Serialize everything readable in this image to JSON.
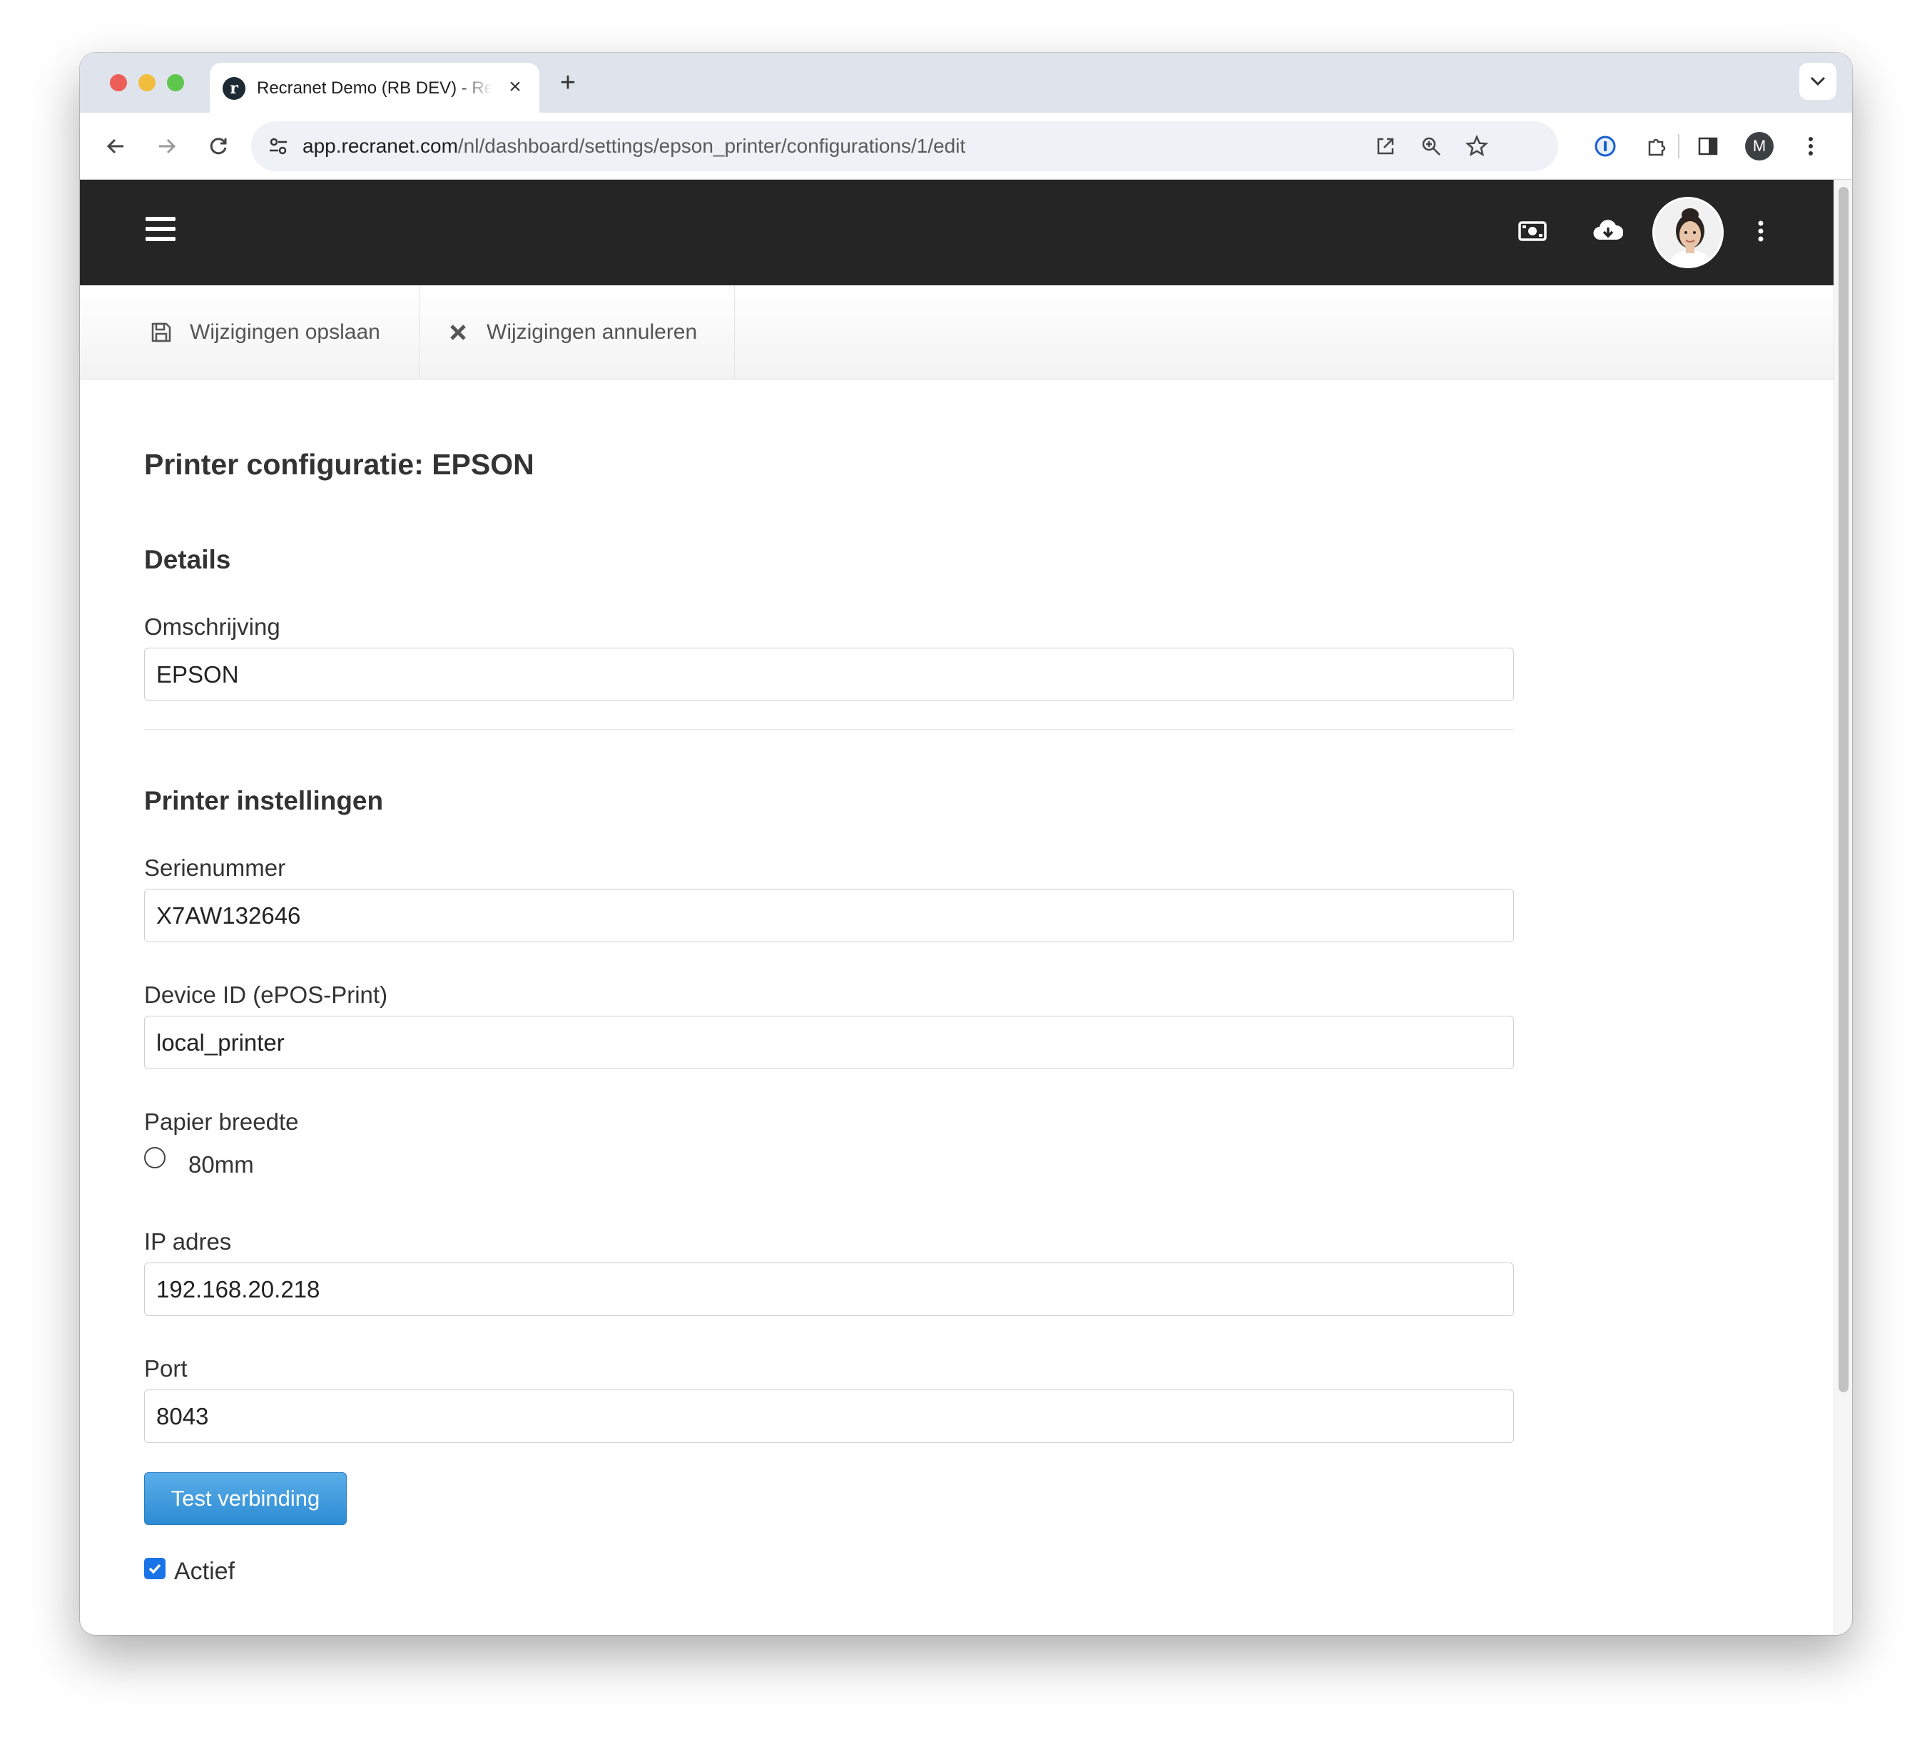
{
  "browser": {
    "tab_title": "Recranet Demo (RB DEV) - Recranet",
    "tab_favicon": "r",
    "url_host": "app.recranet.com",
    "url_path": "/nl/dashboard/settings/epson_printer/configurations/1/edit",
    "profile_initial": "M"
  },
  "actions": {
    "save_label": "Wijzigingen opslaan",
    "cancel_label": "Wijzigingen annuleren"
  },
  "page": {
    "title": "Printer configuratie: EPSON"
  },
  "details": {
    "heading": "Details",
    "description_label": "Omschrijving",
    "description_value": "EPSON"
  },
  "printer_settings": {
    "heading": "Printer instellingen",
    "serial_label": "Serienummer",
    "serial_value": "X7AW132646",
    "device_id_label": "Device ID (ePOS-Print)",
    "device_id_value": "local_printer",
    "paper_width_label": "Papier breedte",
    "paper_width_option": "80mm",
    "paper_width_selected": false,
    "ip_label": "IP adres",
    "ip_value": "192.168.20.218",
    "port_label": "Port",
    "port_value": "8043",
    "test_button_label": "Test verbinding",
    "active_label": "Actief",
    "active_checked": true
  },
  "colors": {
    "appbar": "#252525",
    "primary_button": "#3a9ae0",
    "checkbox": "#1a73e8"
  }
}
